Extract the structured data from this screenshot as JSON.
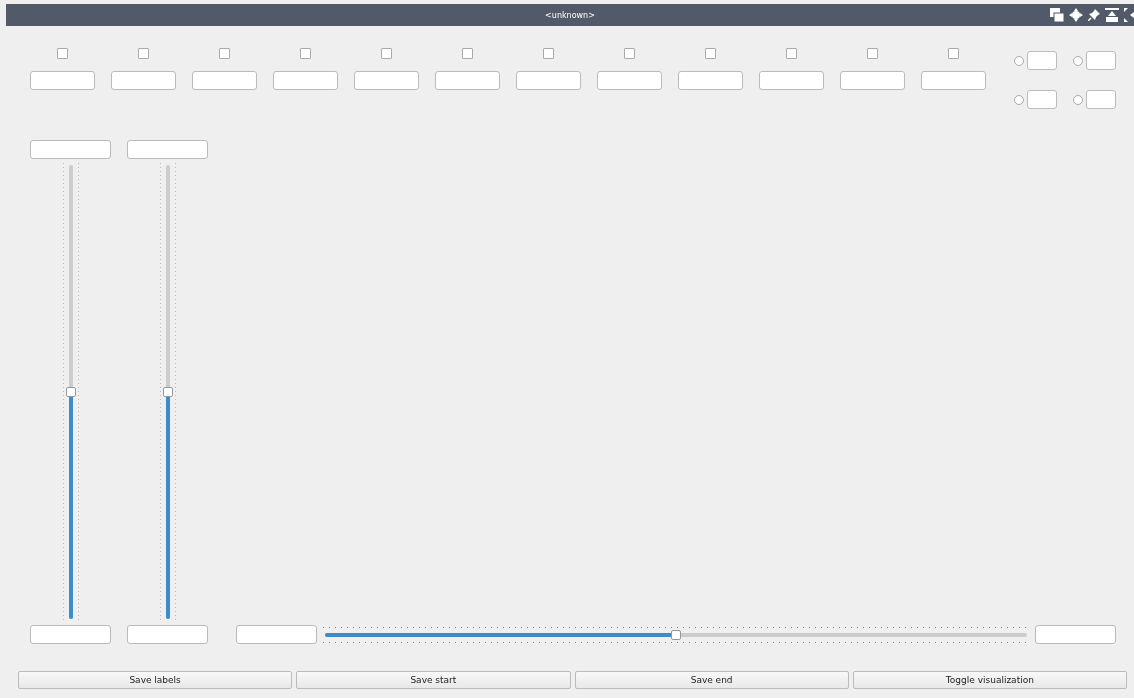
{
  "window": {
    "title": "<unknown>"
  },
  "channels": [
    {
      "checked": false
    },
    {
      "checked": false
    },
    {
      "checked": false
    },
    {
      "checked": false
    },
    {
      "checked": false
    },
    {
      "checked": false
    },
    {
      "checked": false
    },
    {
      "checked": false
    },
    {
      "checked": false
    },
    {
      "checked": false
    },
    {
      "checked": false
    },
    {
      "checked": false
    }
  ],
  "options": [
    {
      "selected": false
    },
    {
      "selected": false
    },
    {
      "selected": false
    },
    {
      "selected": false
    }
  ],
  "vertical_sliders": [
    {
      "level": 0.5
    },
    {
      "level": 0.5
    }
  ],
  "timeline": {
    "level": 0.5
  },
  "buttons": [
    "Save labels",
    "Save start",
    "Save end",
    "Toggle visualization"
  ]
}
